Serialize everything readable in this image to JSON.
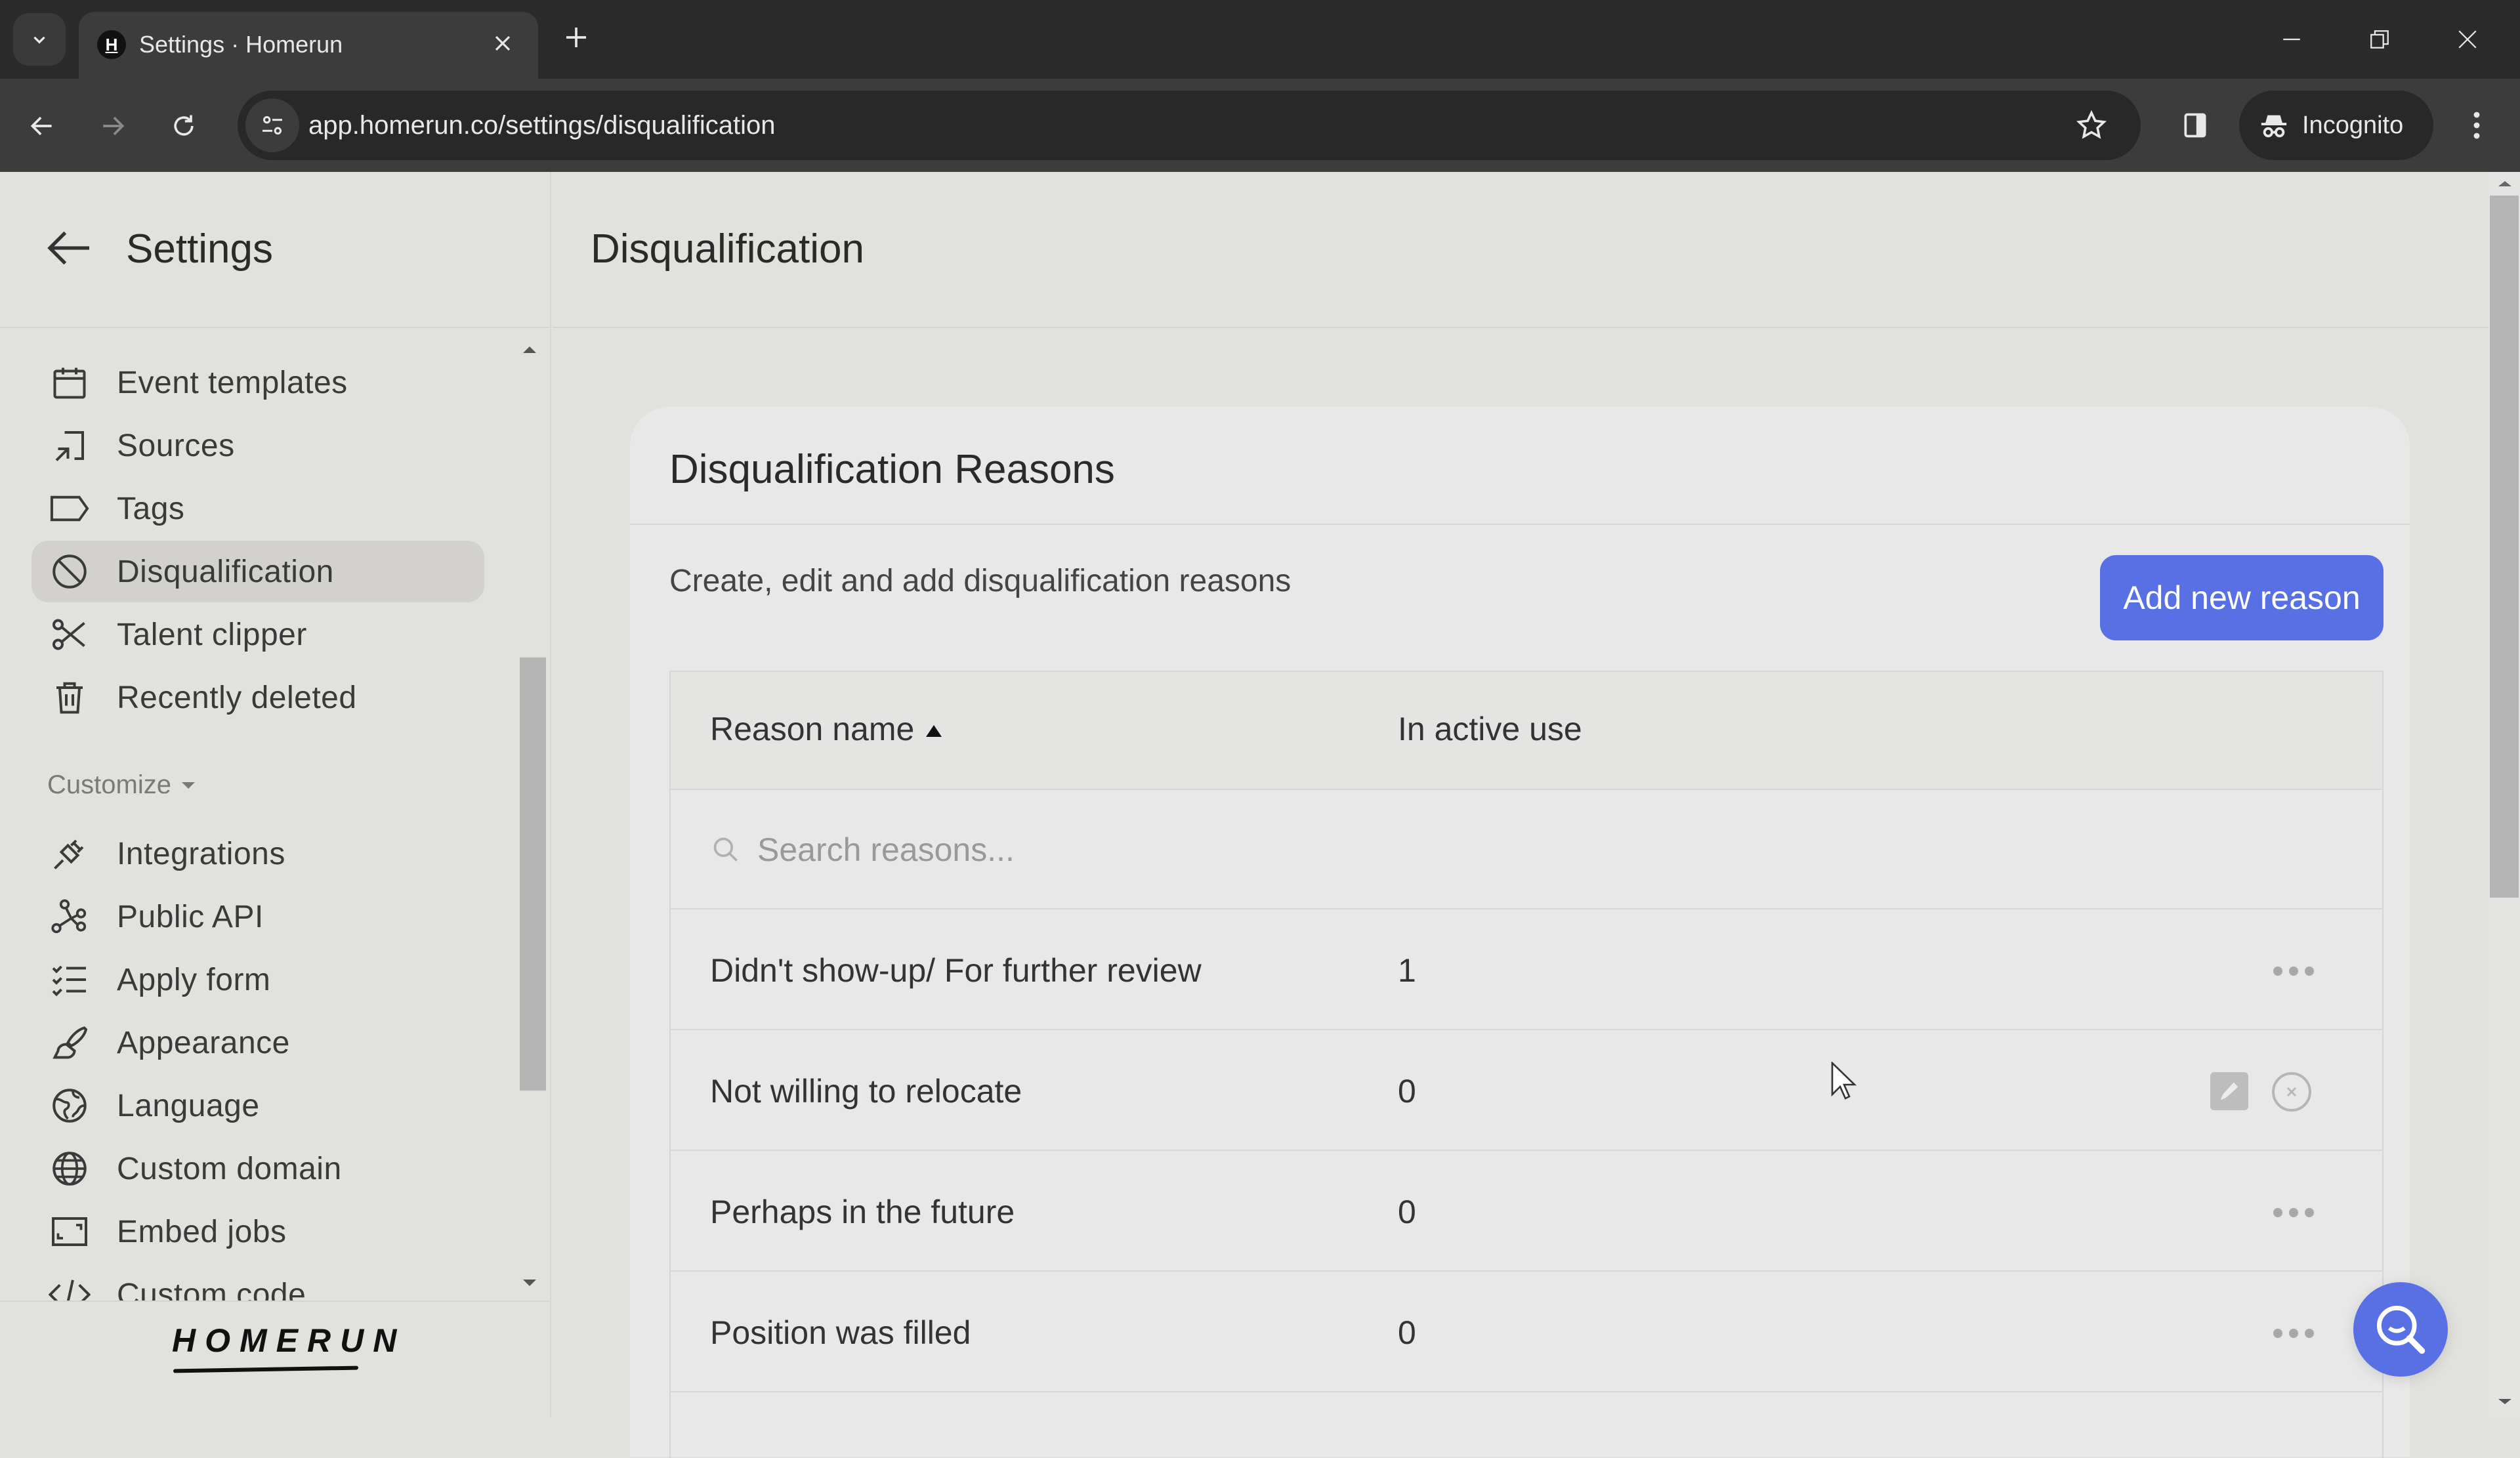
{
  "browser": {
    "tab_title": "Settings · Homerun",
    "favicon_letter": "H",
    "url": "app.homerun.co/settings/disqualification",
    "profile_label": "Incognito"
  },
  "sidebar": {
    "title": "Settings",
    "items": [
      {
        "label": "Event templates",
        "icon": "calendar-icon"
      },
      {
        "label": "Sources",
        "icon": "source-arrow-icon"
      },
      {
        "label": "Tags",
        "icon": "tag-icon"
      },
      {
        "label": "Disqualification",
        "icon": "ban-icon",
        "active": true
      },
      {
        "label": "Talent clipper",
        "icon": "scissors-icon"
      },
      {
        "label": "Recently deleted",
        "icon": "trash-icon"
      }
    ],
    "section_label": "Customize",
    "customize_items": [
      {
        "label": "Integrations",
        "icon": "plug-icon"
      },
      {
        "label": "Public API",
        "icon": "api-nodes-icon"
      },
      {
        "label": "Apply form",
        "icon": "checklist-icon"
      },
      {
        "label": "Appearance",
        "icon": "brush-icon"
      },
      {
        "label": "Language",
        "icon": "earth-icon"
      },
      {
        "label": "Custom domain",
        "icon": "globe-icon"
      },
      {
        "label": "Embed jobs",
        "icon": "embed-icon"
      },
      {
        "label": "Custom code",
        "icon": "code-icon"
      }
    ],
    "logo_text": "HOMERUN"
  },
  "main": {
    "title": "Disqualification",
    "card": {
      "title": "Disqualification Reasons",
      "description": "Create, edit and add disqualification reasons",
      "add_button_label": "Add new reason",
      "table": {
        "columns": [
          "Reason name",
          "In active use"
        ],
        "sort_column": "Reason name",
        "sort_direction": "ascending",
        "search_placeholder": "Search reasons...",
        "search_value": "",
        "rows": [
          {
            "name": "Didn't show-up/ For further review",
            "in_active_use": "1",
            "hovered": false
          },
          {
            "name": "Not willing to relocate",
            "in_active_use": "0",
            "hovered": true
          },
          {
            "name": "Perhaps in the future",
            "in_active_use": "0",
            "hovered": false
          },
          {
            "name": "Position was filled",
            "in_active_use": "0",
            "hovered": false
          }
        ]
      }
    }
  },
  "colors": {
    "accent": "#5870e4",
    "page_background": "#e1e1de",
    "card_background": "#e8e8e8",
    "active_nav_background": "#d2d1ce"
  }
}
